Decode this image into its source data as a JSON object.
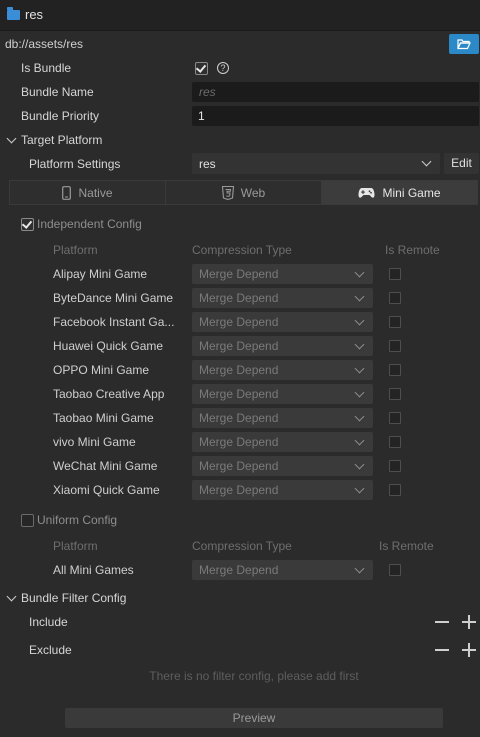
{
  "window": {
    "title": "res"
  },
  "path": "db://assets/res",
  "is_bundle": {
    "label": "Is Bundle",
    "checked": true
  },
  "bundle_name": {
    "label": "Bundle Name",
    "placeholder": "res"
  },
  "bundle_priority": {
    "label": "Bundle Priority",
    "value": "1"
  },
  "target_platform": {
    "label": "Target Platform",
    "platform_settings_label": "Platform Settings",
    "platform_settings_value": "res",
    "edit_label": "Edit"
  },
  "tabs": [
    {
      "label": "Native",
      "icon": "phone-icon",
      "active": false
    },
    {
      "label": "Web",
      "icon": "html5-icon",
      "active": false
    },
    {
      "label": "Mini Game",
      "icon": "gamepad-icon",
      "active": true
    }
  ],
  "independent_config": {
    "label": "Independent Config",
    "checked": true,
    "headers": {
      "platform": "Platform",
      "compression": "Compression Type",
      "remote": "Is Remote"
    },
    "rows": [
      {
        "platform": "Alipay Mini Game",
        "compression": "Merge Depend"
      },
      {
        "platform": "ByteDance Mini Game",
        "compression": "Merge Depend"
      },
      {
        "platform": "Facebook Instant Ga...",
        "compression": "Merge Depend"
      },
      {
        "platform": "Huawei Quick Game",
        "compression": "Merge Depend"
      },
      {
        "platform": "OPPO Mini Game",
        "compression": "Merge Depend"
      },
      {
        "platform": "Taobao Creative App",
        "compression": "Merge Depend"
      },
      {
        "platform": "Taobao Mini Game",
        "compression": "Merge Depend"
      },
      {
        "platform": "vivo Mini Game",
        "compression": "Merge Depend"
      },
      {
        "platform": "WeChat Mini Game",
        "compression": "Merge Depend"
      },
      {
        "platform": "Xiaomi Quick Game",
        "compression": "Merge Depend"
      }
    ]
  },
  "uniform_config": {
    "label": "Uniform Config",
    "checked": false,
    "headers": {
      "platform": "Platform",
      "compression": "Compression Type",
      "remote": "Is Remote"
    },
    "row": {
      "platform": "All Mini Games",
      "compression": "Merge Depend"
    }
  },
  "bundle_filter": {
    "label": "Bundle Filter Config",
    "include_label": "Include",
    "exclude_label": "Exclude",
    "empty_text": "There is no filter config, please add first"
  },
  "preview_label": "Preview",
  "colors": {
    "accent": "#2c89c8",
    "folder": "#3a8ed8",
    "background": "#2b2b2b"
  }
}
